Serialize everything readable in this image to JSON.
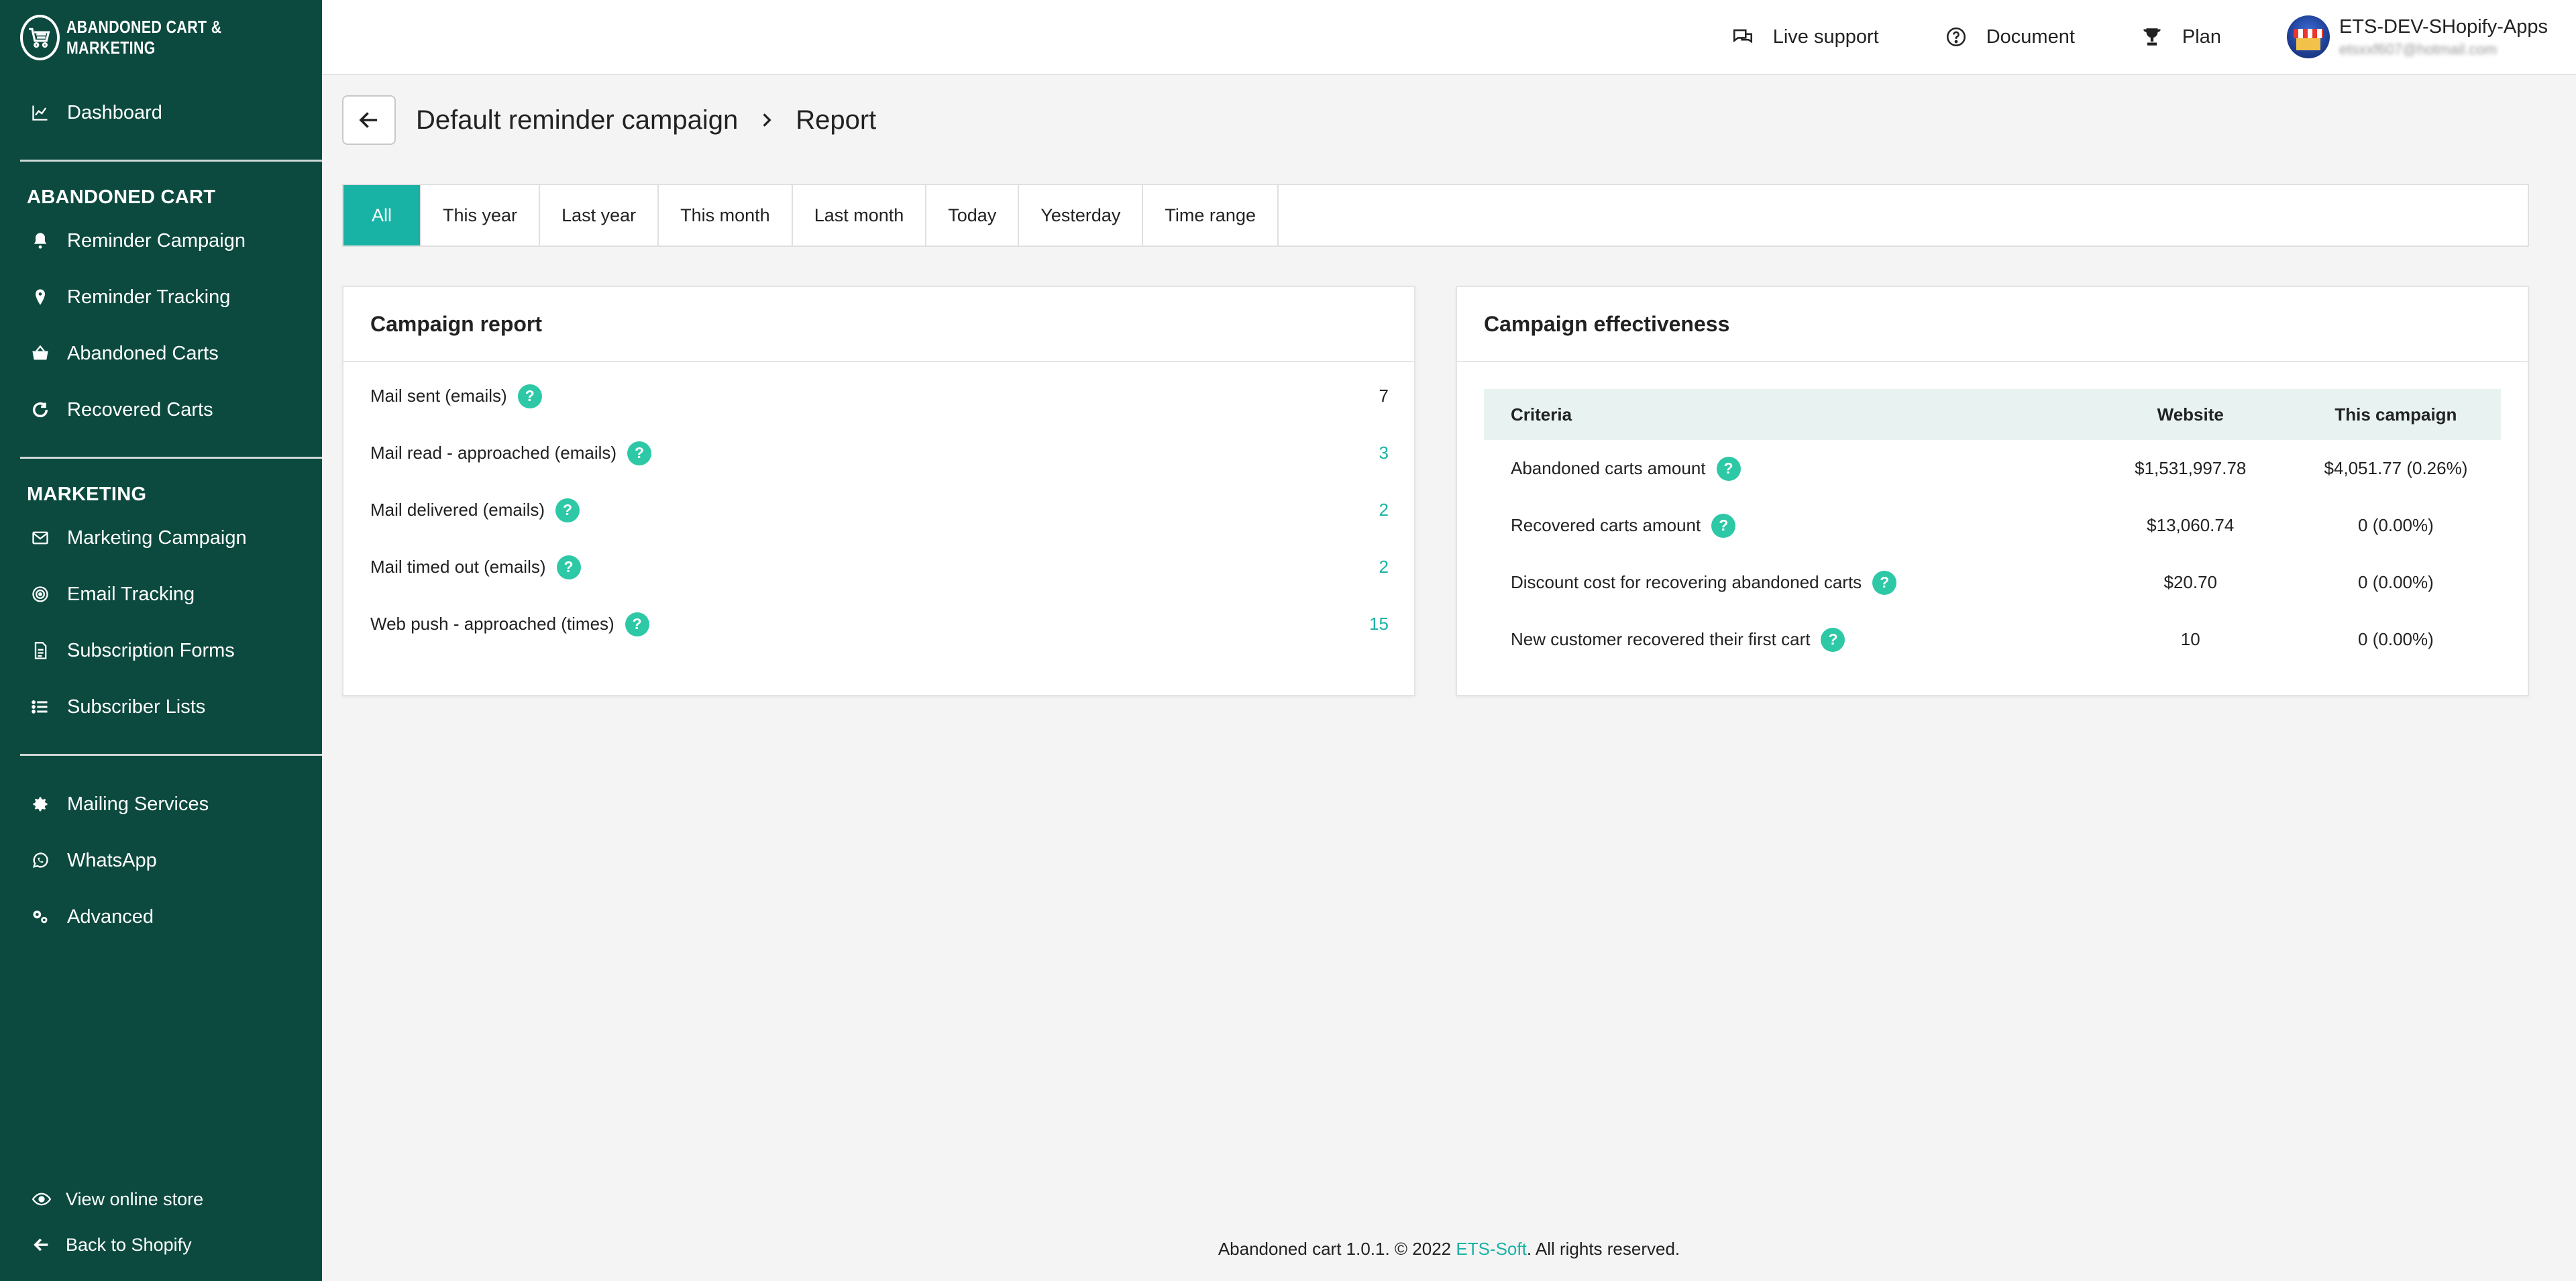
{
  "brand": {
    "name": "ABANDONED CART & MARKETING"
  },
  "sidebar": {
    "dashboard": "Dashboard",
    "section_abandoned": "ABANDONED CART",
    "abandoned_items": [
      {
        "label": "Reminder Campaign",
        "icon": "bell-icon"
      },
      {
        "label": "Reminder Tracking",
        "icon": "map-pin-icon"
      },
      {
        "label": "Abandoned Carts",
        "icon": "basket-icon"
      },
      {
        "label": "Recovered Carts",
        "icon": "refresh-icon"
      }
    ],
    "section_marketing": "MARKETING",
    "marketing_items": [
      {
        "label": "Marketing Campaign",
        "icon": "envelope-icon"
      },
      {
        "label": "Email Tracking",
        "icon": "target-icon"
      },
      {
        "label": "Subscription Forms",
        "icon": "document-icon"
      },
      {
        "label": "Subscriber Lists",
        "icon": "list-icon"
      }
    ],
    "other_items": [
      {
        "label": "Mailing Services",
        "icon": "gear-icon"
      },
      {
        "label": "WhatsApp",
        "icon": "whatsapp-icon"
      },
      {
        "label": "Advanced",
        "icon": "cogs-icon"
      }
    ],
    "view_store": "View online store",
    "back_shopify": "Back to Shopify"
  },
  "topbar": {
    "live_support": "Live support",
    "document": "Document",
    "plan": "Plan",
    "account_name": "ETS-DEV-SHopify-Apps",
    "account_email": "etsxxf607@hotmail.com"
  },
  "header": {
    "campaign": "Default reminder campaign",
    "page": "Report"
  },
  "filters": [
    "All",
    "This year",
    "Last year",
    "This month",
    "Last month",
    "Today",
    "Yesterday",
    "Time range"
  ],
  "active_filter": "All",
  "campaign_report": {
    "title": "Campaign report",
    "rows": [
      {
        "label": "Mail sent (emails)",
        "value": "7"
      },
      {
        "label": "Mail read - approached (emails)",
        "value": "3"
      },
      {
        "label": "Mail delivered (emails)",
        "value": "2"
      },
      {
        "label": "Mail timed out (emails)",
        "value": "2"
      },
      {
        "label": "Web push - approached (times)",
        "value": "15"
      }
    ]
  },
  "effectiveness": {
    "title": "Campaign effectiveness",
    "headers": [
      "Criteria",
      "Website",
      "This campaign"
    ],
    "rows": [
      {
        "criteria": "Abandoned carts amount",
        "website": "$1,531,997.78",
        "campaign": "$4,051.77 (0.26%)"
      },
      {
        "criteria": "Recovered carts amount",
        "website": "$13,060.74",
        "campaign": "0 (0.00%)"
      },
      {
        "criteria": "Discount cost for recovering abandoned carts",
        "website": "$20.70",
        "campaign": "0 (0.00%)"
      },
      {
        "criteria": "New customer recovered their first cart",
        "website": "10",
        "campaign": "0 (0.00%)"
      }
    ]
  },
  "footer": {
    "prefix": "Abandoned cart 1.0.1. © 2022 ",
    "link": "ETS-Soft",
    "suffix": ". All rights reserved."
  },
  "help_glyph": "?",
  "colors": {
    "sidebar": "#0c4a3f",
    "accent": "#19b3a5",
    "help": "#2dc8a6"
  }
}
